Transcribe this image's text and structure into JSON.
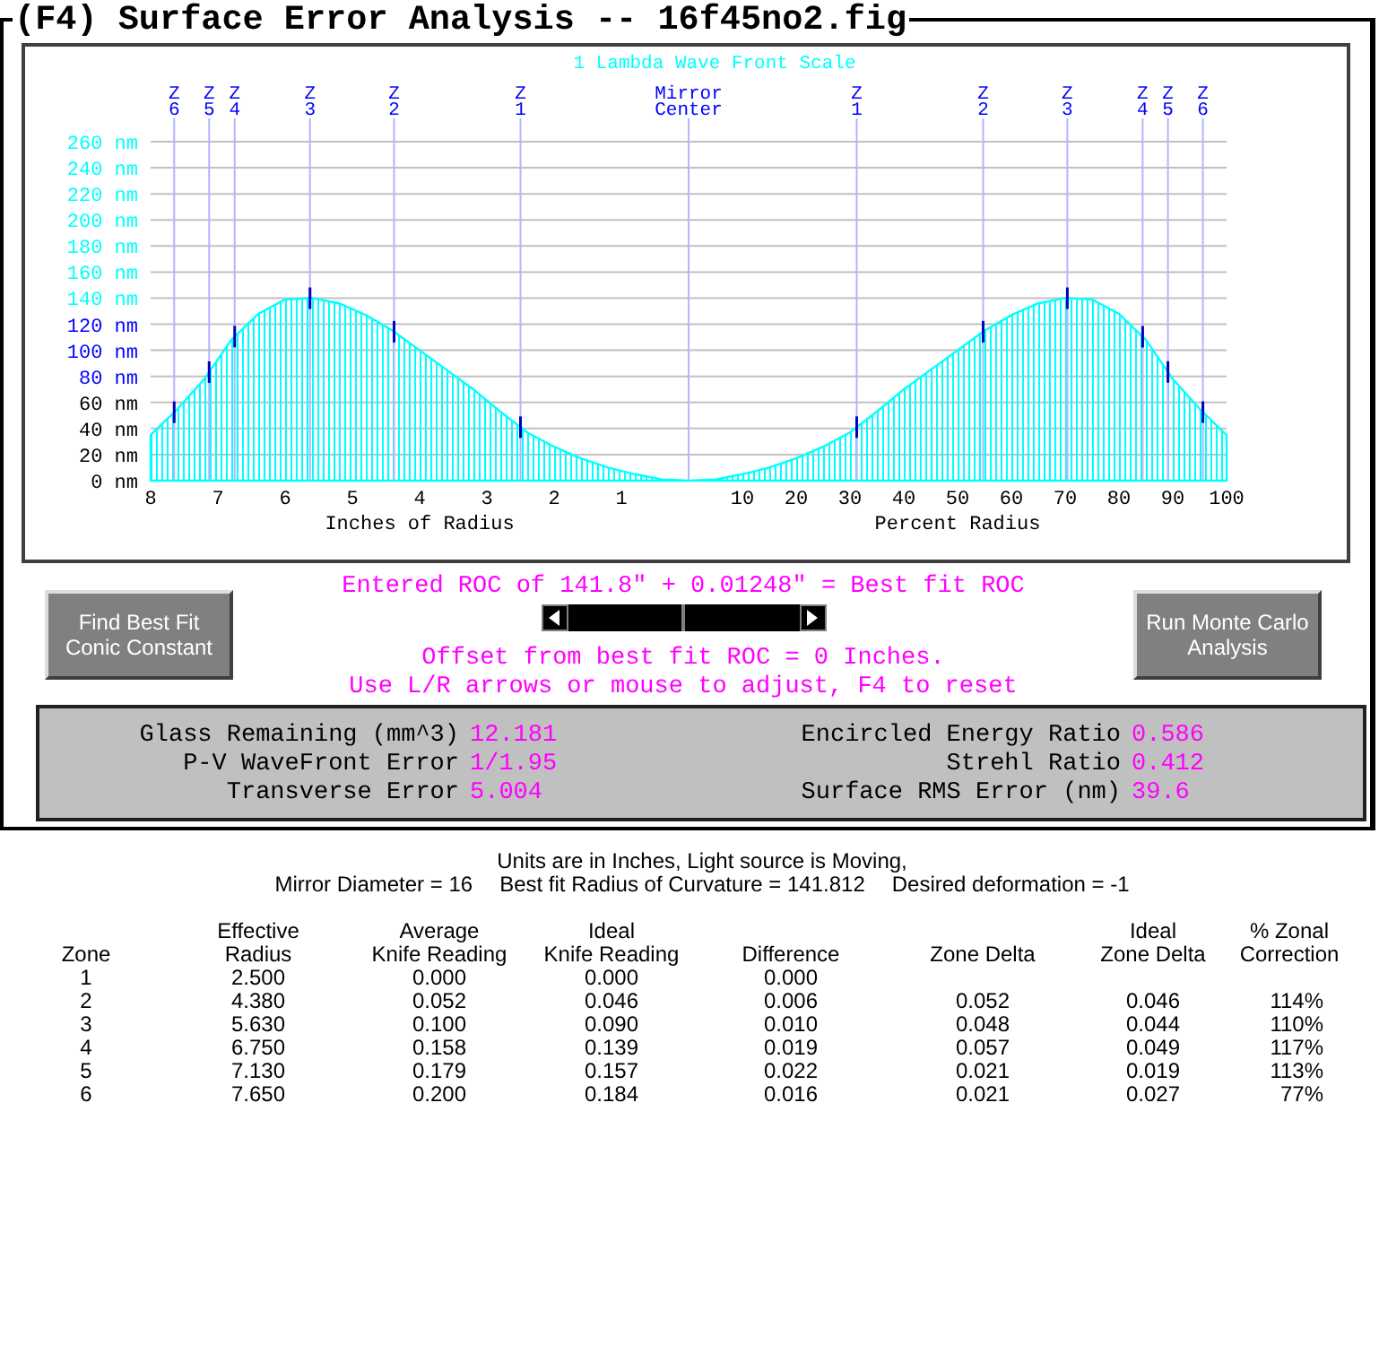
{
  "window": {
    "title": "(F4) Surface Error Analysis -- 16f45no2.fig"
  },
  "plot": {
    "title": "1 Lambda Wave Front Scale",
    "tick_label_colors": [
      {
        "color": "#000000"
      },
      {
        "color": "#000000"
      },
      {
        "color": "#000000"
      },
      {
        "color": "#000000"
      },
      {
        "color": "#0000ff"
      },
      {
        "color": "#0000ff"
      },
      {
        "color": "#0000ff"
      },
      {
        "color": "#00ffff"
      },
      {
        "color": "#00ffff"
      },
      {
        "color": "#00ffff"
      },
      {
        "color": "#00ffff"
      },
      {
        "color": "#00ffff"
      },
      {
        "color": "#00ffff"
      },
      {
        "color": "#00ffff"
      }
    ],
    "charts": [
      {
        "chart_data": {
          "type": "area",
          "xlabel": "Inches of Radius",
          "x": [
            8,
            7.6,
            7.2,
            6.8,
            6.4,
            6,
            5.6,
            5.2,
            4.8,
            4.4,
            4,
            3.6,
            3.2,
            2.8,
            2.4,
            2,
            1.6,
            1.2,
            0.8,
            0.4,
            0
          ],
          "series": [
            {
              "color": "#00ffff",
              "values": [
                35,
                55,
                78,
                108,
                128,
                139,
                140,
                136,
                127,
                115,
                100,
                85,
                70,
                53,
                37,
                26,
                17,
                10,
                5,
                1,
                0
              ]
            }
          ],
          "xlim": [
            8,
            0
          ],
          "ylim": [
            0,
            260
          ],
          "xticks": [
            8,
            7,
            6,
            5,
            4,
            3,
            2,
            1
          ],
          "yticks": [
            {
              "value": 0,
              "label": "0 nm"
            },
            {
              "value": 20,
              "label": "20 nm"
            },
            {
              "value": 40,
              "label": "40 nm"
            },
            {
              "value": 60,
              "label": "60 nm"
            },
            {
              "value": 80,
              "label": "80 nm"
            },
            {
              "value": 100,
              "label": "100 nm"
            },
            {
              "value": 120,
              "label": "120 nm"
            },
            {
              "value": 140,
              "label": "140 nm"
            },
            {
              "value": 160,
              "label": "160 nm"
            },
            {
              "value": 180,
              "label": "180 nm"
            },
            {
              "value": 200,
              "label": "200 nm"
            },
            {
              "value": 220,
              "label": "220 nm"
            },
            {
              "value": 240,
              "label": "240 nm"
            },
            {
              "value": 260,
              "label": "260 nm"
            }
          ],
          "grid": true,
          "ref_lines": [
            {
              "axis": "x",
              "value": 7.65,
              "label": "Z 6"
            },
            {
              "axis": "x",
              "value": 7.13,
              "label": "Z 5"
            },
            {
              "axis": "x",
              "value": 6.75,
              "label": "Z 4"
            },
            {
              "axis": "x",
              "value": 5.63,
              "label": "Z 3"
            },
            {
              "axis": "x",
              "value": 4.38,
              "label": "Z 2"
            },
            {
              "axis": "x",
              "value": 2.5,
              "label": "Z 1"
            }
          ]
        }
      },
      {
        "chart_data": {
          "type": "area",
          "xlabel": "Percent Radius",
          "x": [
            0,
            5,
            10,
            15,
            20,
            25,
            30,
            35,
            40,
            45,
            50,
            55,
            60,
            65,
            70,
            75,
            80,
            85,
            90,
            95,
            100
          ],
          "series": [
            {
              "color": "#00ffff",
              "values": [
                0,
                1,
                5,
                10,
                17,
                26,
                37,
                53,
                70,
                85,
                100,
                115,
                127,
                136,
                140,
                139,
                128,
                108,
                78,
                55,
                35
              ]
            }
          ],
          "xlim": [
            0,
            100
          ],
          "ylim": [
            0,
            260
          ],
          "xticks": [
            10,
            20,
            30,
            40,
            50,
            60,
            70,
            80,
            90,
            100
          ],
          "grid": true,
          "ref_lines": [
            {
              "axis": "x",
              "value": 0,
              "label": "Mirror Center"
            },
            {
              "axis": "x",
              "value": 31.25,
              "label": "Z 1"
            },
            {
              "axis": "x",
              "value": 54.75,
              "label": "Z 2"
            },
            {
              "axis": "x",
              "value": 70.4,
              "label": "Z 3"
            },
            {
              "axis": "x",
              "value": 84.4,
              "label": "Z 4"
            },
            {
              "axis": "x",
              "value": 89.1,
              "label": "Z 5"
            },
            {
              "axis": "x",
              "value": 95.6,
              "label": "Z 6"
            }
          ]
        }
      }
    ]
  },
  "buttons": [
    "Find Best Fit Conic Constant",
    "Run Monte Carlo Analysis"
  ],
  "roc": {
    "entered": "Entered ROC of 141.8\" + 0.01248\" = Best fit ROC",
    "offset": "Offset from best fit ROC = 0 Inches.",
    "hint": "Use L/R arrows or mouse to adjust, F4 to reset"
  },
  "stats": [
    {
      "label": "Glass Remaining (mm^3)",
      "value": "12.181"
    },
    {
      "label": "Encircled Energy Ratio",
      "value": "0.586"
    },
    {
      "label": "P-V WaveFront Error",
      "value": "1/1.95"
    },
    {
      "label": "Strehl Ratio",
      "value": "0.412"
    },
    {
      "label": "Transverse Error",
      "value": "5.004"
    },
    {
      "label": "Surface RMS Error (nm)",
      "value": "39.6"
    }
  ],
  "summary": {
    "line_1": "Units are in Inches, Light source is Moving,",
    "line_2": [
      "Mirror Diameter = 16",
      "Best fit Radius of Curvature = 141.812",
      "Desired deformation = -1"
    ]
  },
  "table": {
    "columns": [
      "Zone",
      "Effective\nRadius",
      "Average\nKnife Reading",
      "Ideal\nKnife Reading",
      "Difference",
      "Zone Delta",
      "Ideal\nZone Delta",
      "% Zonal\nCorrection"
    ],
    "rows": [
      [
        "1",
        "2.500",
        "0.000",
        "0.000",
        "0.000"
      ],
      [
        "2",
        "4.380",
        "0.052",
        "0.046",
        "0.006",
        "0.052",
        "0.046",
        "114%"
      ],
      [
        "3",
        "5.630",
        "0.100",
        "0.090",
        "0.010",
        "0.048",
        "0.044",
        "110%"
      ],
      [
        "4",
        "6.750",
        "0.158",
        "0.139",
        "0.019",
        "0.057",
        "0.049",
        "117%"
      ],
      [
        "5",
        "7.130",
        "0.179",
        "0.157",
        "0.022",
        "0.021",
        "0.019",
        "113%"
      ],
      [
        "6",
        "7.650",
        "0.200",
        "0.184",
        "0.016",
        "0.021",
        "0.027",
        "77%"
      ]
    ]
  }
}
